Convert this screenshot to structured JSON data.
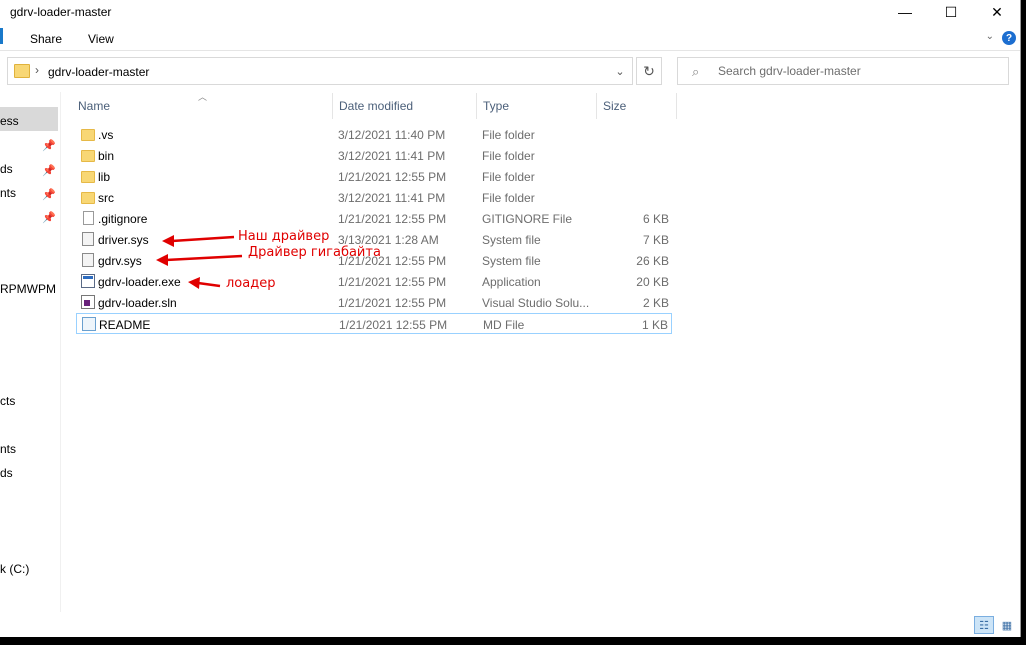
{
  "window": {
    "title": "gdrv-loader-master",
    "minimize": "—",
    "maximize": "☐",
    "close": "✕"
  },
  "ribbon": {
    "tabs": [
      "Share",
      "View"
    ],
    "expand": "⌄",
    "help": "?"
  },
  "address": {
    "separator": "›",
    "path": "gdrv-loader-master",
    "dropdown": "⌄",
    "refresh": "↻"
  },
  "search": {
    "placeholder": "Search gdrv-loader-master"
  },
  "nav": {
    "items": [
      {
        "label": "ess"
      },
      {
        "label": "ds"
      },
      {
        "label": "nts"
      },
      {
        "label": "RPMWPM"
      },
      {
        "label": "cts"
      },
      {
        "label": "nts"
      },
      {
        "label": "ds"
      },
      {
        "label": "k (C:)"
      }
    ]
  },
  "columns": {
    "name": "Name",
    "date": "Date modified",
    "type": "Type",
    "size": "Size"
  },
  "files": [
    {
      "name": ".vs",
      "date": "3/12/2021 11:40 PM",
      "type": "File folder",
      "size": "",
      "icon": "folder-icon"
    },
    {
      "name": "bin",
      "date": "3/12/2021 11:41 PM",
      "type": "File folder",
      "size": "",
      "icon": "folder-icon"
    },
    {
      "name": "lib",
      "date": "1/21/2021 12:55 PM",
      "type": "File folder",
      "size": "",
      "icon": "folder-icon"
    },
    {
      "name": "src",
      "date": "3/12/2021 11:41 PM",
      "type": "File folder",
      "size": "",
      "icon": "folder-icon"
    },
    {
      "name": ".gitignore",
      "date": "1/21/2021 12:55 PM",
      "type": "GITIGNORE File",
      "size": "6 KB",
      "icon": "file-icon"
    },
    {
      "name": "driver.sys",
      "date": "3/13/2021 1:28 AM",
      "type": "System file",
      "size": "7 KB",
      "icon": "system-file-icon"
    },
    {
      "name": "gdrv.sys",
      "date": "1/21/2021 12:55 PM",
      "type": "System file",
      "size": "26 KB",
      "icon": "system-file-icon"
    },
    {
      "name": "gdrv-loader.exe",
      "date": "1/21/2021 12:55 PM",
      "type": "Application",
      "size": "20 KB",
      "icon": "application-icon"
    },
    {
      "name": "gdrv-loader.sln",
      "date": "1/21/2021 12:55 PM",
      "type": "Visual Studio Solu...",
      "size": "2 KB",
      "icon": "visual-studio-icon"
    },
    {
      "name": "README",
      "date": "1/21/2021 12:55 PM",
      "type": "MD File",
      "size": "1 KB",
      "icon": "markdown-file-icon"
    }
  ],
  "annotations": {
    "driver": "Наш драйвер",
    "gdrv": "Драйвер гигабайта",
    "loader": "лоадер"
  },
  "colors": {
    "annotation": "#e00000",
    "selection_border": "#99d1ff",
    "header_text": "#4c607a"
  }
}
